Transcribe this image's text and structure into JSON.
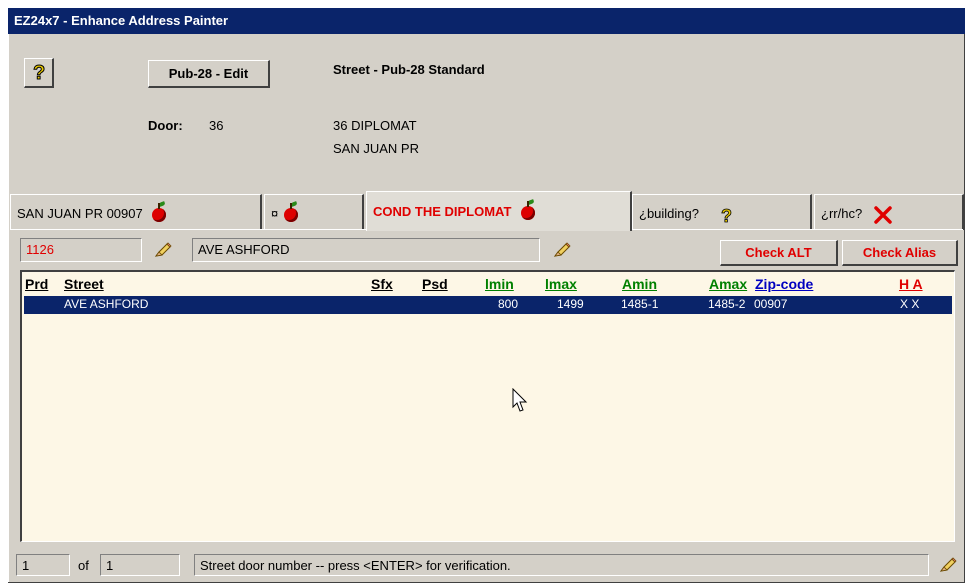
{
  "window": {
    "title": "EZ24x7 - Enhance Address Painter"
  },
  "header": {
    "help_label": "?",
    "edit_button": "Pub-28 - Edit",
    "standard_title": "Street - Pub-28 Standard",
    "door_label": "Door:",
    "door_value": "36",
    "address_line1": "36 DIPLOMAT",
    "address_line2": "SAN JUAN PR"
  },
  "tabs": [
    {
      "label": "SAN JUAN PR 00907",
      "icon": "apple-icon"
    },
    {
      "label": "¤",
      "icon": "apple-icon"
    },
    {
      "label": "COND THE DIPLOMAT",
      "icon": "apple-icon"
    },
    {
      "label": "¿building?",
      "icon": "question-icon"
    },
    {
      "label": "¿rr/hc?",
      "icon": "x-icon"
    }
  ],
  "search": {
    "number_value": "1126",
    "street_value": "AVE ASHFORD",
    "check_alt": "Check ALT",
    "check_alias": "Check Alias"
  },
  "table": {
    "headers": {
      "prd": "Prd",
      "street": "Street",
      "sfx": "Sfx",
      "psd": "Psd",
      "lmin": "lmin",
      "lmax": "lmax",
      "amin": "Amin",
      "amax": "Amax",
      "zip": "Zip-code",
      "ha": "H A"
    },
    "rows": [
      {
        "street": "AVE ASHFORD",
        "lmin": "800",
        "lmax": "1499",
        "amin": "1485-1",
        "amax": "1485-2",
        "zip": "00907",
        "ha": "X X"
      }
    ]
  },
  "status": {
    "page": "1",
    "of_label": "of",
    "total": "1",
    "message": "Street door number  --  press <ENTER> for verification."
  },
  "colors": {
    "title_bg": "#0a246a",
    "accent_red": "#e00000",
    "green": "#008000",
    "blue": "#0000c0",
    "list_bg": "#fdf7e6"
  }
}
